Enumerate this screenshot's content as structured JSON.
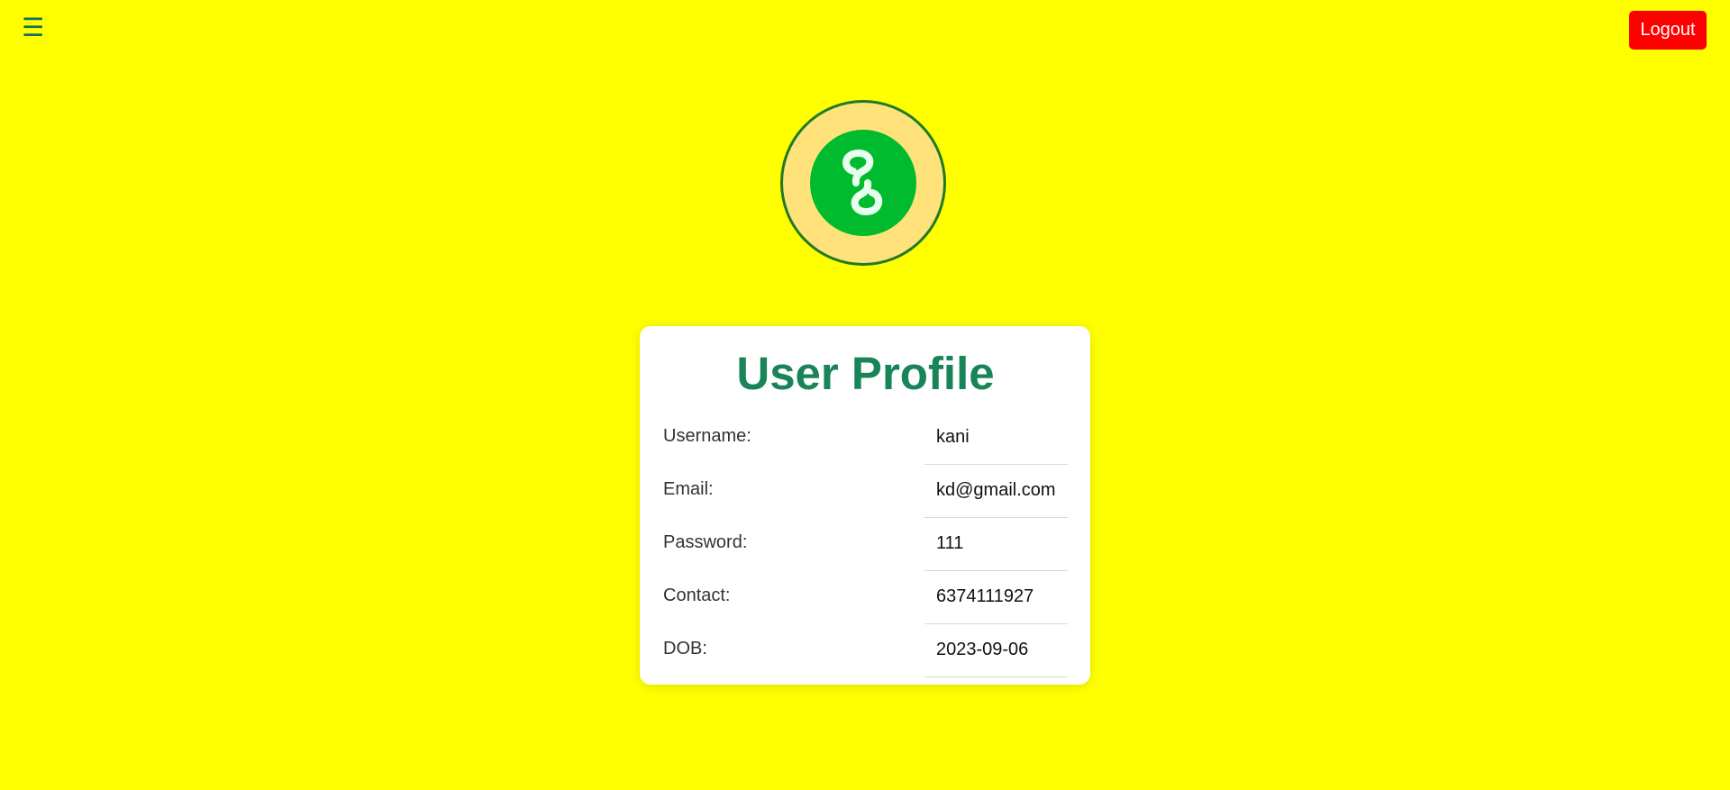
{
  "header": {
    "menu_icon": "hamburger-menu-icon",
    "menu_glyph": "☰",
    "logout_label": "Logout"
  },
  "logo": {
    "icon": "chain-link-icon"
  },
  "profile": {
    "title": "User Profile",
    "rows": [
      {
        "label": "Username:",
        "value": "kani"
      },
      {
        "label": "Email:",
        "value": "kd@gmail.com"
      },
      {
        "label": "Password:",
        "value": "111"
      },
      {
        "label": "Contact:",
        "value": "6374111927"
      },
      {
        "label": "DOB:",
        "value": "2023-09-06"
      }
    ]
  },
  "colors": {
    "background": "#ffff00",
    "logout": "#ff0000",
    "title": "#188457",
    "logo_ring": "#ffe37a",
    "logo_center": "#00bb2d"
  }
}
